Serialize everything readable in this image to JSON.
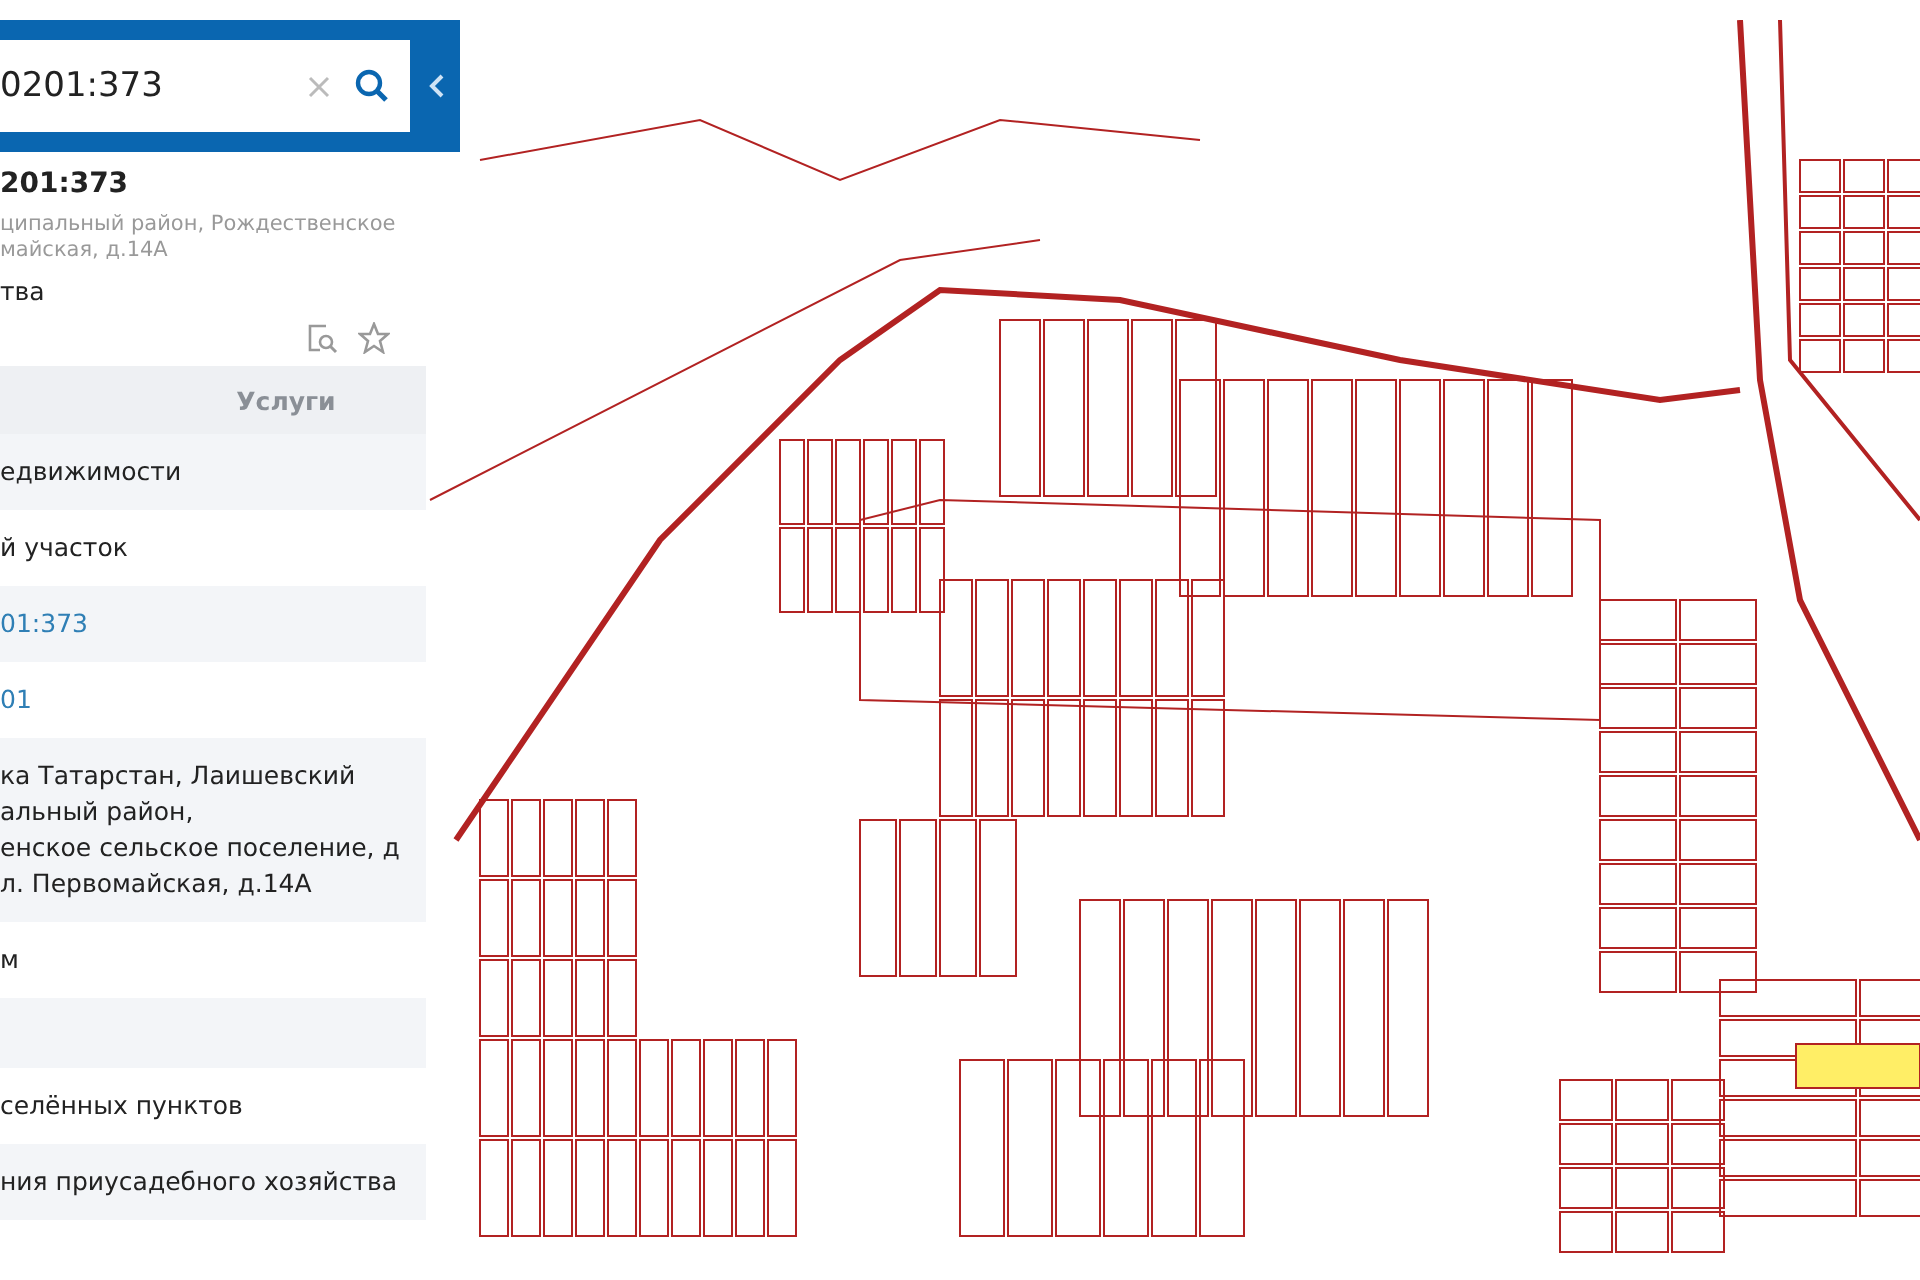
{
  "search": {
    "value": "0201:373"
  },
  "card": {
    "title": "201:373",
    "address_lines": [
      "ципальный район, Рождественское",
      "майская, д.14А"
    ],
    "category": "тва"
  },
  "tabs": [
    {
      "label": "Услуги",
      "selected": false
    }
  ],
  "rows": [
    {
      "kind": "text",
      "lines": [
        "едвижимости"
      ]
    },
    {
      "kind": "text",
      "lines": [
        "й участок"
      ]
    },
    {
      "kind": "link",
      "lines": [
        "01:373"
      ]
    },
    {
      "kind": "link",
      "lines": [
        "01"
      ]
    },
    {
      "kind": "text",
      "lines": [
        "ка Татарстан, Лаишевский",
        "альный район,",
        "енское сельское поселение, д",
        "л. Первомайская, д.14А"
      ]
    },
    {
      "kind": "text",
      "lines": [
        "м"
      ]
    },
    {
      "kind": "blank",
      "lines": []
    },
    {
      "kind": "text",
      "lines": [
        "селённых пунктов"
      ]
    },
    {
      "kind": "text",
      "lines": [
        "ния приусадебного хозяйства"
      ]
    }
  ]
}
